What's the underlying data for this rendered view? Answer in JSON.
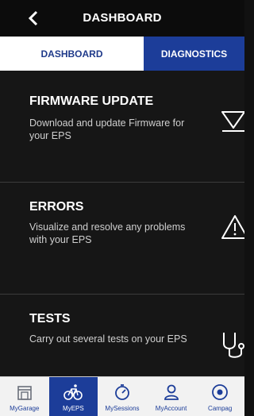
{
  "header": {
    "title": "DASHBOARD"
  },
  "tabs": [
    {
      "label": "DASHBOARD",
      "active": false
    },
    {
      "label": "DIAGNOSTICS",
      "active": true
    }
  ],
  "items": [
    {
      "title": "FIRMWARE UPDATE",
      "description": "Download and update Firmware for your EPS",
      "icon": "download-icon"
    },
    {
      "title": "ERRORS",
      "description": "Visualize and resolve any problems with your EPS",
      "icon": "warning-icon"
    },
    {
      "title": "TESTS",
      "description": "Carry out several tests on your EPS",
      "icon": "stethoscope-icon"
    }
  ],
  "bottom_nav": [
    {
      "label": "MyGarage",
      "icon": "garage-icon",
      "active": false
    },
    {
      "label": "MyEPS",
      "icon": "bicycle-icon",
      "active": true
    },
    {
      "label": "MySessions",
      "icon": "stopwatch-icon",
      "active": false
    },
    {
      "label": "MyAccount",
      "icon": "user-icon",
      "active": false
    },
    {
      "label": "Campag",
      "icon": "campag-logo-icon",
      "active": false
    }
  ],
  "colors": {
    "accent": "#1c3d99",
    "background": "#161616",
    "header": "#0c0c0c",
    "nav_bg": "#f2f2f2"
  }
}
